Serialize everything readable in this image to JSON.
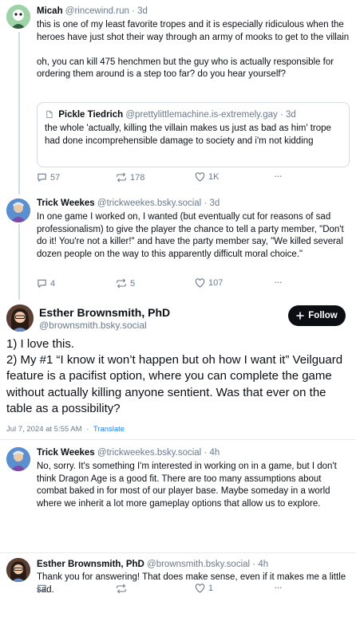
{
  "posts": [
    {
      "name": "Micah",
      "handle": "@rincewind.run",
      "time": "· 3d",
      "text": "this is one of my least favorite tropes and it is especially ridiculous when the heroes have just shot their way through an army of mooks to get to the villain\n\noh, you can kill 475 henchmen but the guy who is actually responsible for ordering them around is a step too far? do you hear yourself?",
      "quote": {
        "name": "Pickle Tiedrich",
        "handle": "@prettylittlemachine.is-extremely.gay",
        "time": "· 3d",
        "text": "the whole 'actually, killing the villain makes us just as bad as him' trope had done incomprehensible damage to society and i'm not kidding"
      },
      "replies": "57",
      "reposts": "178",
      "likes": "1K"
    },
    {
      "name": "Trick Weekes",
      "handle": "@trickweekes.bsky.social",
      "time": "· 3d",
      "text": "In one game I worked on, I wanted (but eventually cut for reasons of sad professionalism) to give the player the chance to tell a party member, \"Don't do it! You're not a killer!\" and have the party member say, \"We killed several dozen people on the way to this apparently difficult moral choice.\"",
      "replies": "4",
      "reposts": "5",
      "likes": "107"
    }
  ],
  "main_post": {
    "name": "Esther Brownsmith, PhD",
    "handle": "@brownsmith.bsky.social",
    "follow_label": "Follow",
    "text": "1) I love this.\n2) My #1 “I know it won’t happen but oh how I want it” Veilguard feature is a pacifist option, where you can complete the game without actually killing anyone sentient. Was that ever on the table as a possibility?",
    "timestamp": "Jul 7, 2024 at 5:55 AM",
    "separator": "·",
    "translate": "Translate"
  },
  "reply_posts": [
    {
      "name": "Trick Weekes",
      "handle": "@trickweekes.bsky.social",
      "time": "· 4h",
      "text": "No, sorry. It's something I'm interested in working on in a game, but I don't think Dragon Age is a good fit. There are too many assumptions about combat baked in for most of our player base. Maybe someday in a world where we inherit a lot more gameplay options that allow us to explore."
    },
    {
      "name": "Esther Brownsmith, PhD",
      "handle": "@brownsmith.bsky.social",
      "time": "· 4h",
      "text": "Thank you for answering! That does make sense, even if it makes me a little sad.",
      "likes": "1"
    }
  ],
  "more_label": "···",
  "colors": {
    "accent": "#1083fe",
    "muted": "#6b7a8a",
    "border": "#d4dbe2"
  }
}
